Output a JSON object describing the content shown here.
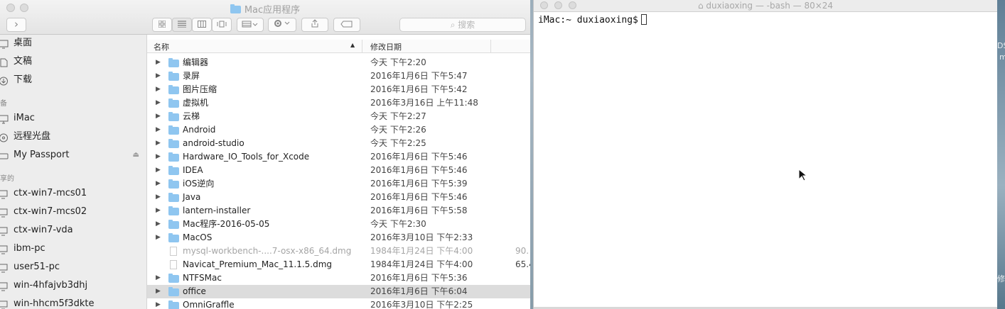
{
  "finder": {
    "title": "Mac应用程序",
    "search_placeholder": "搜索",
    "nav_forward": "›",
    "sidebar": {
      "favorites": [
        {
          "label": "桌面",
          "icon": "desktop-icon"
        },
        {
          "label": "文稿",
          "icon": "document-icon"
        },
        {
          "label": "下载",
          "icon": "download-icon"
        }
      ],
      "devices_header": "备",
      "devices": [
        {
          "label": "iMac",
          "icon": "computer-icon"
        },
        {
          "label": "远程光盘",
          "icon": "disc-icon"
        },
        {
          "label": "My Passport",
          "icon": "drive-icon"
        }
      ],
      "shared_header": "享的",
      "shared": [
        {
          "label": "ctx-win7-mcs01",
          "icon": "pc-icon"
        },
        {
          "label": "ctx-win7-mcs02",
          "icon": "pc-icon"
        },
        {
          "label": "ctx-win7-vda",
          "icon": "pc-icon"
        },
        {
          "label": "ibm-pc",
          "icon": "pc-icon"
        },
        {
          "label": "user51-pc",
          "icon": "pc-icon"
        },
        {
          "label": "win-4hfajvb3dhj",
          "icon": "pc-icon"
        },
        {
          "label": "win-hhcm5f3dkte",
          "icon": "pc-icon"
        }
      ]
    },
    "columns": {
      "name": "名称",
      "date": "修改日期"
    },
    "rows": [
      {
        "name": "编辑器",
        "date": "今天 下午2:20",
        "size": "",
        "kind": "folder"
      },
      {
        "name": "录屏",
        "date": "2016年1月6日 下午5:47",
        "size": "",
        "kind": "folder"
      },
      {
        "name": "图片压缩",
        "date": "2016年1月6日 下午5:42",
        "size": "",
        "kind": "folder"
      },
      {
        "name": "虚拟机",
        "date": "2016年3月16日 上午11:48",
        "size": "",
        "kind": "folder"
      },
      {
        "name": "云梯",
        "date": "今天 下午2:27",
        "size": "",
        "kind": "folder"
      },
      {
        "name": "Android",
        "date": "今天 下午2:26",
        "size": "",
        "kind": "folder"
      },
      {
        "name": "android-studio",
        "date": "今天 下午2:25",
        "size": "",
        "kind": "folder"
      },
      {
        "name": "Hardware_IO_Tools_for_Xcode",
        "date": "2016年1月6日 下午5:46",
        "size": "",
        "kind": "folder"
      },
      {
        "name": "IDEA",
        "date": "2016年1月6日 下午5:46",
        "size": "",
        "kind": "folder"
      },
      {
        "name": "iOS逆向",
        "date": "2016年1月6日 下午5:39",
        "size": "",
        "kind": "folder"
      },
      {
        "name": "Java",
        "date": "2016年1月6日 下午5:46",
        "size": "",
        "kind": "folder"
      },
      {
        "name": "lantern-installer",
        "date": "2016年1月6日 下午5:58",
        "size": "",
        "kind": "folder"
      },
      {
        "name": "Mac程序-2016-05-05",
        "date": "今天 下午2:30",
        "size": "",
        "kind": "folder"
      },
      {
        "name": "MacOS",
        "date": "2016年3月10日 下午2:33",
        "size": "",
        "kind": "folder"
      },
      {
        "name": "mysql-workbench-....7-osx-x86_64.dmg",
        "date": "1984年1月24日 下午4:00",
        "size": "90.",
        "kind": "file-dim"
      },
      {
        "name": "Navicat_Premium_Mac_11.1.5.dmg",
        "date": "1984年1月24日 下午4:00",
        "size": "65.4",
        "kind": "file"
      },
      {
        "name": "NTFSMac",
        "date": "2016年1月6日 下午5:36",
        "size": "",
        "kind": "folder"
      },
      {
        "name": "office",
        "date": "2016年1月6日 下午6:04",
        "size": "",
        "kind": "folder-selected"
      },
      {
        "name": "OmniGraffle",
        "date": "2016年3月10日 下午2:25",
        "size": "",
        "kind": "folder"
      }
    ]
  },
  "terminal": {
    "title": "duxiaoxing — -bash — 80×24",
    "prompt": "iMac:~ duxiaoxing$"
  },
  "desktop": {
    "edge_text_1": "DS",
    "edge_text_2": "m",
    "edge_text_3": "修"
  }
}
